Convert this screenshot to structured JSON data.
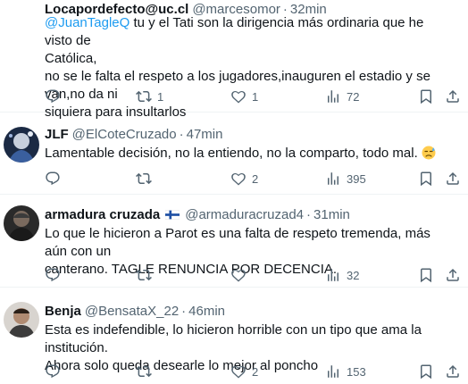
{
  "tweets": [
    {
      "name": "Locapordefecto@uc.cl",
      "handle": "@marcesomor",
      "time": "32min",
      "mention": "@JuanTagleQ",
      "lines": [
        " tu y el Tati son la dirigencia más ordinaria que he visto de",
        "Católica,",
        "no se le falta el respeto a los jugadores,inauguren el estadio y se van,no da ni",
        "siquiera para insultarlos"
      ],
      "replies": "",
      "retweets": "1",
      "likes": "1",
      "views": "72"
    },
    {
      "name": "JLF",
      "handle": "@ElCoteCruzado",
      "time": "47min",
      "lines": [
        "Lamentable decisión, no la entiendo, no la comparto, todo mal. "
      ],
      "emoji": "sad-sweat-face",
      "replies": "",
      "retweets": "",
      "likes": "2",
      "views": "395"
    },
    {
      "name": "armadura cruzada",
      "flag": "finland-flag",
      "handle": "@armaduracruzad4",
      "time": "31min",
      "lines": [
        "Lo que le hicieron a Parot es una falta de respeto tremenda, más aún con un",
        "canterano. TAGLE RENUNCIA POR DECENCIA."
      ],
      "replies": "",
      "retweets": "",
      "likes": "",
      "views": "32"
    },
    {
      "name": "Benja",
      "handle": "@BensataX_22",
      "time": "46min",
      "lines": [
        "Esta es indefendible, lo hicieron horrible con un tipo que ama la institución.",
        "Ahora solo queda desearle lo mejor al poncho"
      ],
      "replies": "",
      "retweets": "",
      "likes": "2",
      "views": "153"
    }
  ],
  "separator": "·",
  "colors": {
    "text": "#0f1419",
    "secondary": "#536471",
    "link": "#1d9bf0",
    "border": "#eff3f4"
  }
}
